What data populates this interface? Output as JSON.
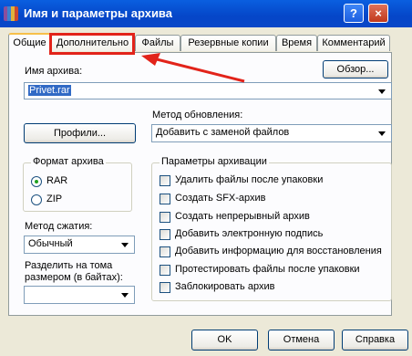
{
  "window": {
    "title": "Имя и параметры архива",
    "help_glyph": "?",
    "close_glyph": "×"
  },
  "tabs": [
    "Общие",
    "Дополнительно",
    "Файлы",
    "Резервные копии",
    "Время",
    "Комментарий"
  ],
  "active_tab": "Общие",
  "archive_name": {
    "label": "Имя архива:",
    "value": "Privet.rar",
    "browse_button": "Обзор..."
  },
  "profiles_button": "Профили...",
  "update_method": {
    "label": "Метод обновления:",
    "value": "Добавить с заменой файлов"
  },
  "archive_format": {
    "title": "Формат архива",
    "options": [
      {
        "label": "RAR",
        "selected": true
      },
      {
        "label": "ZIP",
        "selected": false
      }
    ]
  },
  "compression": {
    "label": "Метод сжатия:",
    "value": "Обычный"
  },
  "split": {
    "label_line1": "Разделить на тома",
    "label_line2": "размером (в байтах):",
    "value": ""
  },
  "archive_options": {
    "title": "Параметры архивации",
    "items": [
      {
        "label": "Удалить файлы после упаковки",
        "checked": false
      },
      {
        "label": "Создать SFX-архив",
        "checked": false
      },
      {
        "label": "Создать непрерывный архив",
        "checked": false
      },
      {
        "label": "Добавить электронную подпись",
        "checked": false
      },
      {
        "label": "Добавить информацию для восстановления",
        "checked": false
      },
      {
        "label": "Протестировать файлы после упаковки",
        "checked": false
      },
      {
        "label": "Заблокировать архив",
        "checked": false
      }
    ]
  },
  "footer": {
    "ok": "OK",
    "cancel": "Отмена",
    "help": "Справка"
  },
  "colors": {
    "titlebar": "#0546C8",
    "dialog": "#ECE9D8",
    "annotation": "#E2231A"
  }
}
